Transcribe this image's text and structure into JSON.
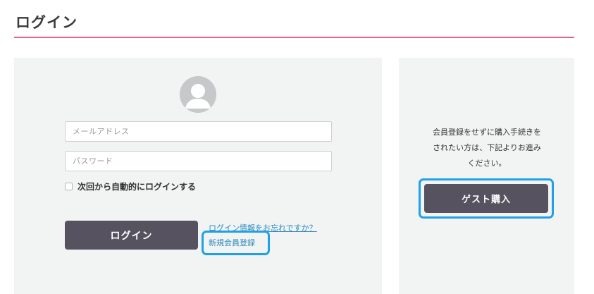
{
  "page": {
    "title": "ログイン",
    "accent_color": "#e0658f"
  },
  "login": {
    "avatar_icon": "user-avatar-icon",
    "email_placeholder": "メールアドレス",
    "password_placeholder": "パスワード",
    "remember_label": "次回から自動的にログインする",
    "remember_checked": false,
    "login_button": "ログイン",
    "forgot_link": "ログイン情報をお忘れですか？",
    "register_link": "新規会員登録"
  },
  "guest": {
    "description_lines": [
      "会員登録をせずに購入手続きを",
      "されたい方は、下記よりお進み",
      "ください。"
    ],
    "guest_button": "ゲスト購入"
  },
  "colors": {
    "button_bg": "#56525f",
    "panel_bg": "#f2f3f3",
    "link": "#2a8bbd",
    "highlight": "#1ea1e6"
  }
}
